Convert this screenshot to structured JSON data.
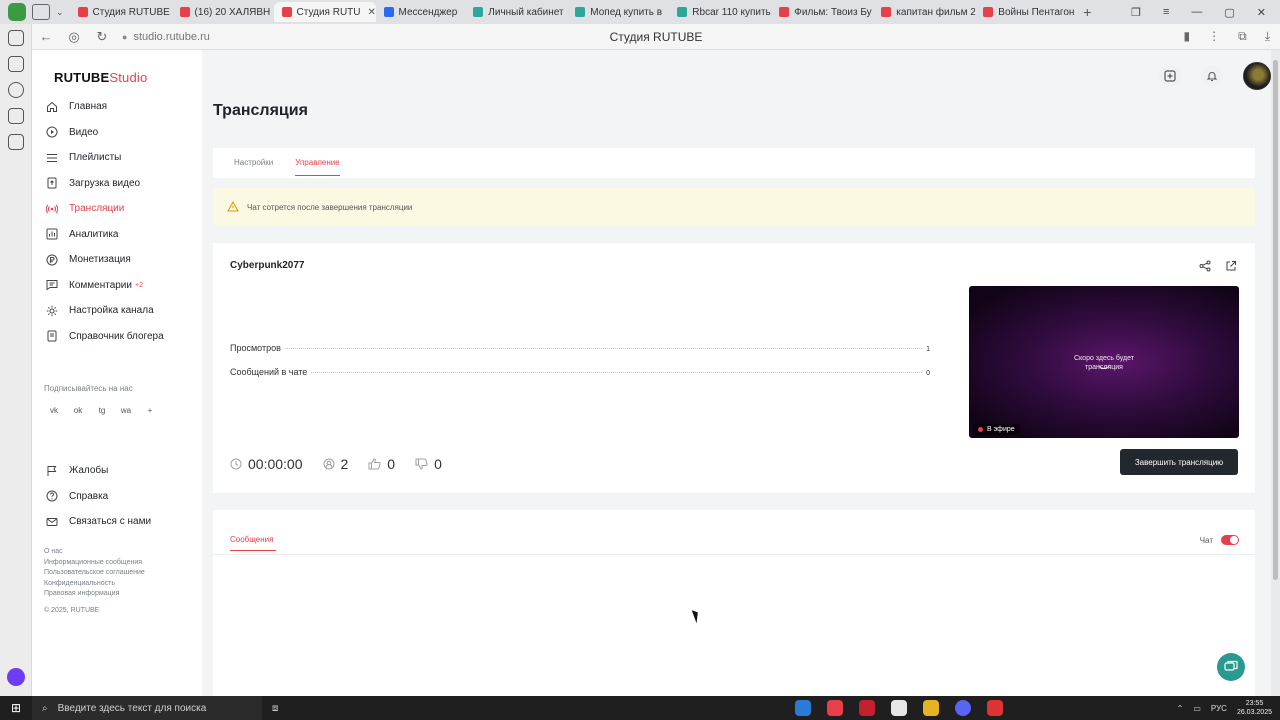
{
  "browser": {
    "tabs": [
      {
        "label": "Студия RUTUBE",
        "color": "#e8404b",
        "active": false
      },
      {
        "label": "(16) 20 ХАЛЯВН",
        "color": "#e8404b",
        "active": false
      },
      {
        "label": "Студия RUTU",
        "color": "#e8404b",
        "active": true
      },
      {
        "label": "Мессенджер",
        "color": "#2a6bf2",
        "active": false
      },
      {
        "label": "Личный кабинет",
        "color": "#2aa89a",
        "active": false
      },
      {
        "label": "Мопед купить в",
        "color": "#2aa89a",
        "active": false
      },
      {
        "label": "Rbcar 110 купить",
        "color": "#2aa89a",
        "active": false
      },
      {
        "label": "Фильм: Твоиз Бу",
        "color": "#e8404b",
        "active": false
      },
      {
        "label": "капитан фильм 2",
        "color": "#e8404b",
        "active": false
      },
      {
        "label": "Войны Пентагон",
        "color": "#e8404b",
        "active": false
      }
    ],
    "url": "studio.rutube.ru",
    "page_title": "Студия RUTUBE"
  },
  "sidebar": {
    "logo_main": "RUTUBE",
    "logo_studio": "Studio",
    "nav": [
      {
        "label": "Главная",
        "icon": "home-icon"
      },
      {
        "label": "Видео",
        "icon": "play-icon"
      },
      {
        "label": "Плейлисты",
        "icon": "list-icon"
      },
      {
        "label": "Загрузка видео",
        "icon": "upload-icon"
      },
      {
        "label": "Трансляции",
        "icon": "broadcast-icon",
        "active": true
      },
      {
        "label": "Аналитика",
        "icon": "analytics-icon"
      },
      {
        "label": "Монетизация",
        "icon": "money-icon"
      },
      {
        "label": "Комментарии",
        "icon": "comment-icon",
        "badge": "+2"
      },
      {
        "label": "Настройка канала",
        "icon": "gear-icon"
      },
      {
        "label": "Справочник блогера",
        "icon": "book-icon"
      }
    ],
    "subscribe_label": "Подписывайтесь на нас",
    "socials": [
      "vk",
      "ok",
      "tg",
      "wa",
      "+"
    ],
    "nav2": [
      {
        "label": "Жалобы",
        "icon": "flag-icon"
      },
      {
        "label": "Справка",
        "icon": "help-icon"
      },
      {
        "label": "Связаться с нами",
        "icon": "mail-icon"
      }
    ],
    "footer_links": [
      "О нас",
      "Информационные сообщения",
      "Пользовательское соглашение",
      "Конфиденциальность",
      "Правовая информация"
    ],
    "copyright": "© 2025, RUTUBE"
  },
  "main": {
    "title": "Трансляция",
    "tabs": [
      {
        "label": "Настройки",
        "active": false
      },
      {
        "label": "Управление",
        "active": true
      }
    ],
    "alert": "Чат сотрется после завершения трансляции",
    "stream": {
      "name": "Cyberpunk2077",
      "stats": [
        {
          "label": "Просмотров",
          "value": "1"
        },
        {
          "label": "Сообщений в чате",
          "value": "0"
        }
      ],
      "timer": "00:00:00",
      "viewers": "2",
      "likes": "0",
      "dislikes": "0",
      "preview_text_1": "Скоро здесь будет",
      "preview_text_2": "трансляция",
      "live_label": "В эфире",
      "end_button": "Завершить трансляцию"
    },
    "chat": {
      "tab_label": "Сообщения",
      "toggle_label": "Чат",
      "toggle_on": true
    }
  },
  "taskbar": {
    "search_placeholder": "Введите здесь текст для поиска",
    "lang": "РУС",
    "time": "23:55",
    "date": "26.03.2025"
  },
  "colors": {
    "accent": "#e8404b",
    "dark_button": "#22282e",
    "alert_bg": "#fcf9e3"
  }
}
